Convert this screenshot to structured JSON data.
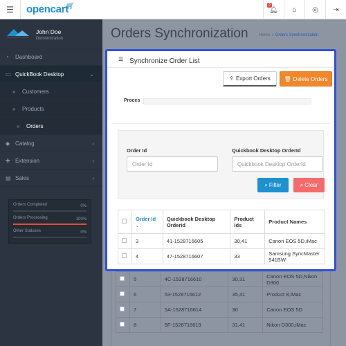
{
  "header": {
    "logo": "opencart",
    "notification_count": "3"
  },
  "sidebar": {
    "profile": {
      "name": "John Doe",
      "role": "Demonstration"
    },
    "items": [
      {
        "label": "Dashboard",
        "icon": "dashboard-icon"
      },
      {
        "label": "QuickBook Desktop",
        "icon": "desktop-icon"
      },
      {
        "label": "Customers"
      },
      {
        "label": "Products"
      },
      {
        "label": "Orders"
      },
      {
        "label": "Catalog",
        "icon": "tag-icon"
      },
      {
        "label": "Extension",
        "icon": "puzzle-icon"
      },
      {
        "label": "Sales",
        "icon": "cart-icon"
      }
    ],
    "stats": [
      {
        "label": "Orders Completed",
        "pct": "0%",
        "value": 0,
        "color": "#e74c3c"
      },
      {
        "label": "Orders Processing",
        "pct": "100%",
        "value": 100,
        "color": "#e74c3c"
      },
      {
        "label": "Other Statuses",
        "pct": "0%",
        "value": 0,
        "color": "#3a4552"
      }
    ]
  },
  "page": {
    "title": "Orders Synchronization",
    "breadcrumb": [
      "Home",
      "Orders Synchronization"
    ]
  },
  "panel": {
    "title": "Synchronize Order List",
    "export_label": "Export Orders",
    "delete_label": "Delete Orders",
    "proces_label": "Proces",
    "filter": {
      "order_id_label": "Order Id",
      "order_id_placeholder": "Order Id",
      "qb_order_id_label": "Quickbook Desktop OrderId",
      "qb_order_id_placeholder": "Quickbook Desktop OrderId",
      "filter_label": "Filter",
      "clear_label": "Clear"
    },
    "table": {
      "headers": [
        "Order Id",
        "Quickbook Desktop OrderId",
        "Product Ids",
        "Product Names"
      ],
      "rows": [
        [
          "3",
          "41-1528716605",
          "30,41",
          "Canon EOS 5D,iMac"
        ],
        [
          "4",
          "47-1528716607",
          "33",
          "Samsung SyncMaster 941BW"
        ],
        [
          "5",
          "4C-1528716610",
          "30,31",
          "Canon EOS 5D,Nikon D300"
        ],
        [
          "6",
          "53-1528716612",
          "35,41",
          "Product 8,iMac"
        ],
        [
          "7",
          "5A-1528716614",
          "30",
          "Canon EOS 5D"
        ],
        [
          "8",
          "5F-1528716619",
          "31,41",
          "Nikon D300,iMac"
        ]
      ]
    }
  },
  "colors": {
    "accent": "#1e91cf",
    "delete": "#f0872a",
    "clear": "#f56b6b",
    "highlight_border": "#2f4fe0",
    "sidebar": "#2b3440"
  }
}
